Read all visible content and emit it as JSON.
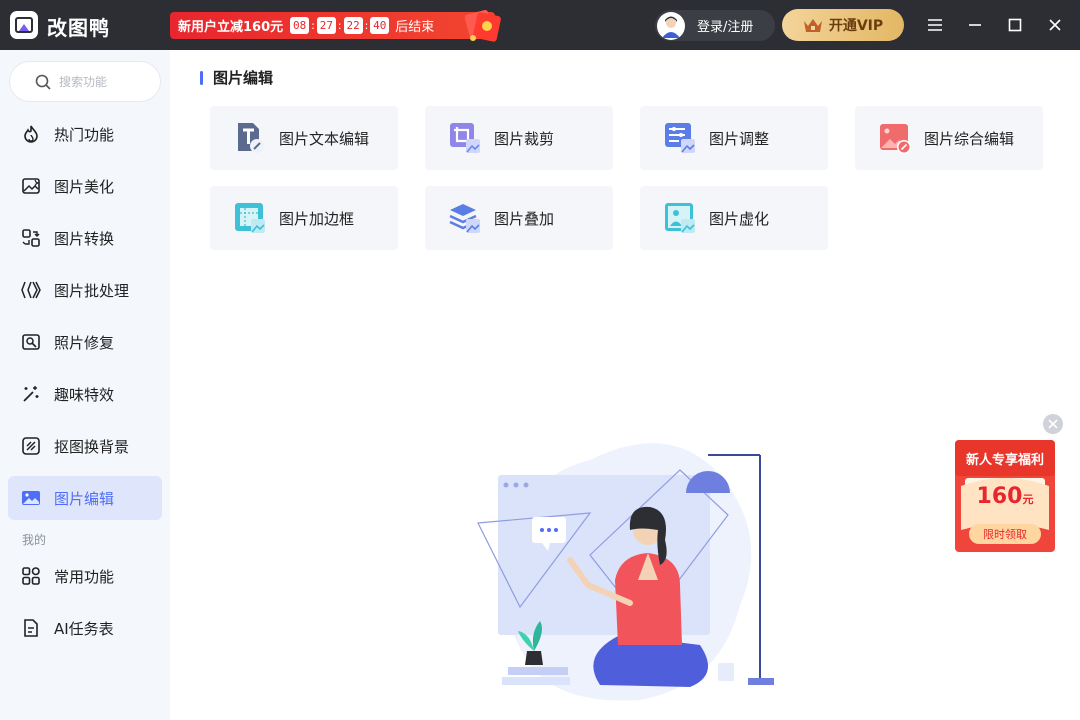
{
  "app": {
    "name": "改图鸭"
  },
  "promo": {
    "text": "新用户立减160元",
    "hours": "08",
    "minutes": "27",
    "seconds": "22",
    "centis": "40",
    "suffix": "后结束"
  },
  "header": {
    "login_label": "登录/注册",
    "vip_label": "开通VIP"
  },
  "search": {
    "placeholder": "搜索功能"
  },
  "sidebar": {
    "items": [
      {
        "label": "热门功能",
        "icon": "fire-icon"
      },
      {
        "label": "图片美化",
        "icon": "image-sparkle-icon"
      },
      {
        "label": "图片转换",
        "icon": "convert-icon"
      },
      {
        "label": "图片批处理",
        "icon": "batch-icon"
      },
      {
        "label": "照片修复",
        "icon": "photo-repair-icon"
      },
      {
        "label": "趣味特效",
        "icon": "magic-wand-icon"
      },
      {
        "label": "抠图换背景",
        "icon": "cutout-icon"
      },
      {
        "label": "图片编辑",
        "icon": "image-edit-icon",
        "active": true
      }
    ],
    "mine_label": "我的",
    "mine_items": [
      {
        "label": "常用功能",
        "icon": "grid-icon"
      },
      {
        "label": "AI任务表",
        "icon": "document-icon"
      }
    ]
  },
  "main": {
    "title": "图片编辑",
    "tools": [
      {
        "label": "图片文本编辑",
        "icon": "text-edit-icon"
      },
      {
        "label": "图片裁剪",
        "icon": "crop-icon"
      },
      {
        "label": "图片调整",
        "icon": "adjust-icon"
      },
      {
        "label": "图片综合编辑",
        "icon": "comprehensive-edit-icon"
      },
      {
        "label": "图片加边框",
        "icon": "border-icon"
      },
      {
        "label": "图片叠加",
        "icon": "overlay-icon"
      },
      {
        "label": "图片虚化",
        "icon": "blur-icon"
      }
    ]
  },
  "ad": {
    "title": "新人专享福利",
    "amount": "160",
    "unit": "元",
    "button": "限时领取"
  },
  "colors": {
    "accent": "#4f6ef7",
    "promo_red": "#e8262e",
    "vip_gold": "#e3b764"
  }
}
